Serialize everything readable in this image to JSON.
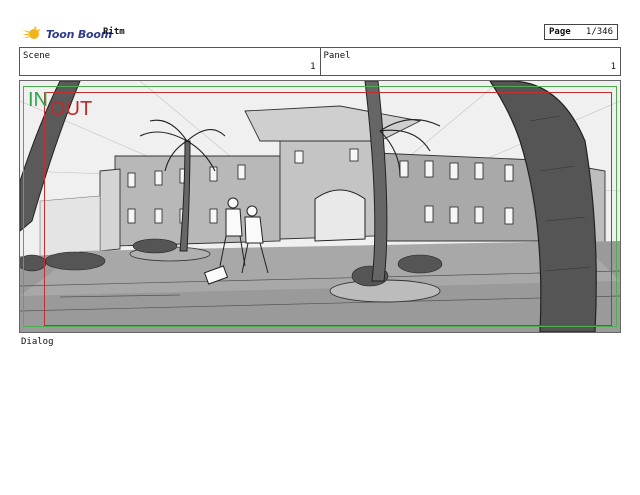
{
  "header": {
    "logo_text": "Toon Boom",
    "project_title": "Ritm",
    "page_label": "Page",
    "page_value": "1/346"
  },
  "scene": {
    "label": "Scene",
    "value": "1"
  },
  "panel": {
    "label": "Panel",
    "value": "1"
  },
  "frame": {
    "in_label": "IN",
    "out_label": "OUT"
  },
  "dialog": {
    "label": "Dialog"
  },
  "colors": {
    "logo_text": "#2f3b8a",
    "logo_mark": "#f2b21b",
    "in_marker": "#2aa84a",
    "out_marker": "#c02a2a",
    "panel_background": "#efefef"
  },
  "icons": {
    "logo": "toon-boom-logo-icon"
  }
}
